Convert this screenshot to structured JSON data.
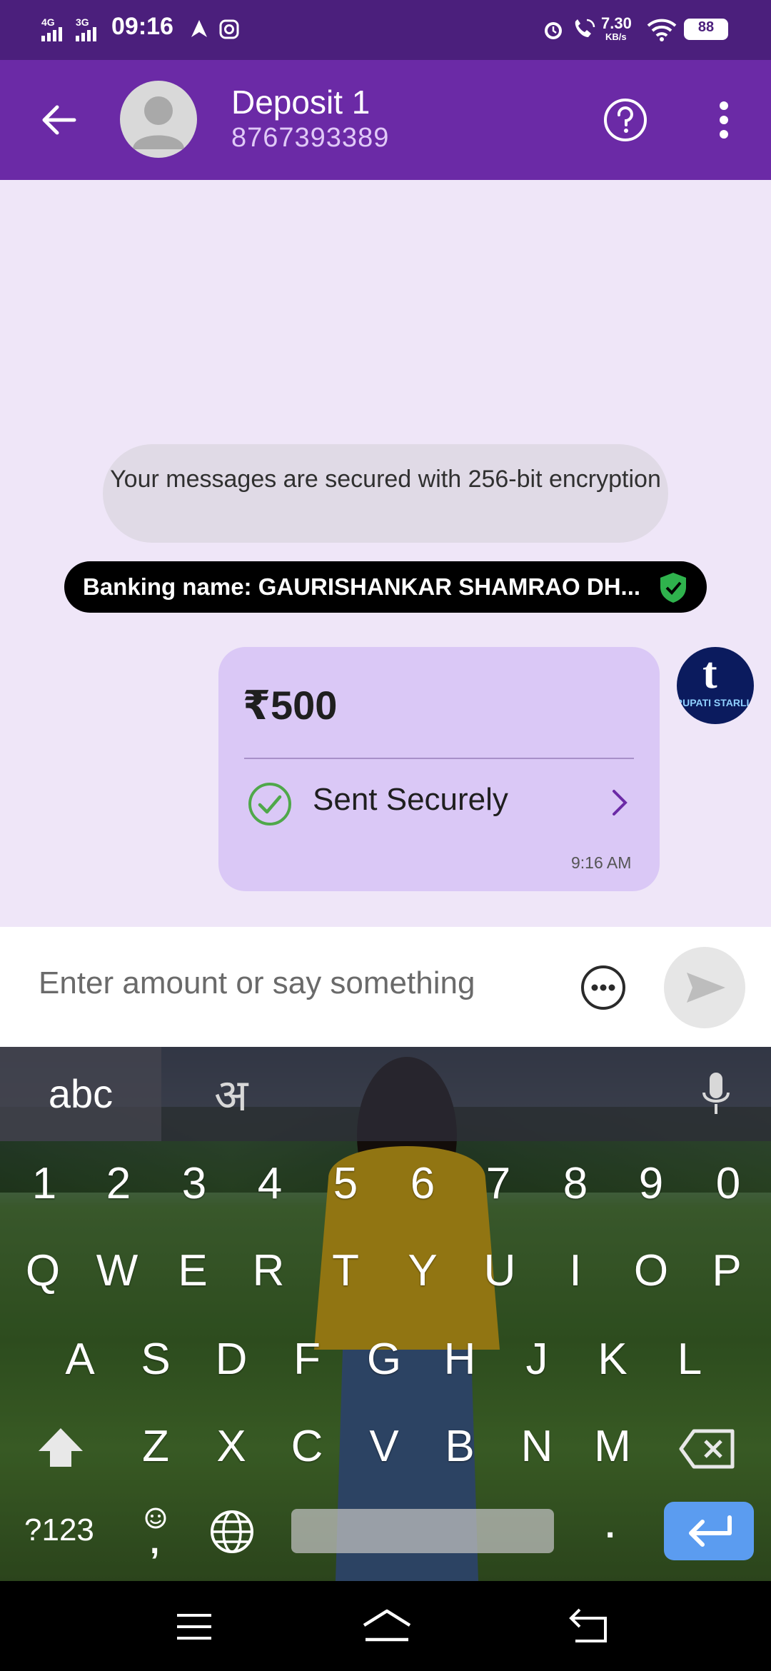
{
  "status_bar": {
    "network": "4G 3G",
    "time": "09:16",
    "speed": "7.30",
    "speed_unit": "KB/s",
    "battery": "88"
  },
  "header": {
    "title": "Deposit 1",
    "subtitle": "8767393389"
  },
  "chat": {
    "encryption_notice": "Your messages are secured with 256-bit encryption",
    "banking_name": "Banking name: GAURISHANKAR SHAMRAO DH...",
    "payment": {
      "amount": "₹500",
      "status": "Sent Securely",
      "time": "9:16 AM"
    },
    "payee_logo_letter": "t",
    "payee_logo_text": "RUPATI STARLI"
  },
  "input": {
    "placeholder": "Enter amount or say something"
  },
  "keyboard": {
    "tab_abc": "abc",
    "tab_hindi": "अ",
    "numbers": [
      "1",
      "2",
      "3",
      "4",
      "5",
      "6",
      "7",
      "8",
      "9",
      "0"
    ],
    "row1": [
      "Q",
      "W",
      "E",
      "R",
      "T",
      "Y",
      "U",
      "I",
      "O",
      "P"
    ],
    "row2": [
      "A",
      "S",
      "D",
      "F",
      "G",
      "H",
      "J",
      "K",
      "L"
    ],
    "row3": [
      "Z",
      "X",
      "C",
      "V",
      "B",
      "N",
      "M"
    ],
    "symbols_key": "?123",
    "comma_key": ",",
    "period_key": "."
  },
  "colors": {
    "status_bar": "#4b1f7c",
    "header": "#6b2aa6",
    "chat_bg": "#efe6f8",
    "bubble": "#dac8f6",
    "enter_key": "#5b9cf0"
  }
}
